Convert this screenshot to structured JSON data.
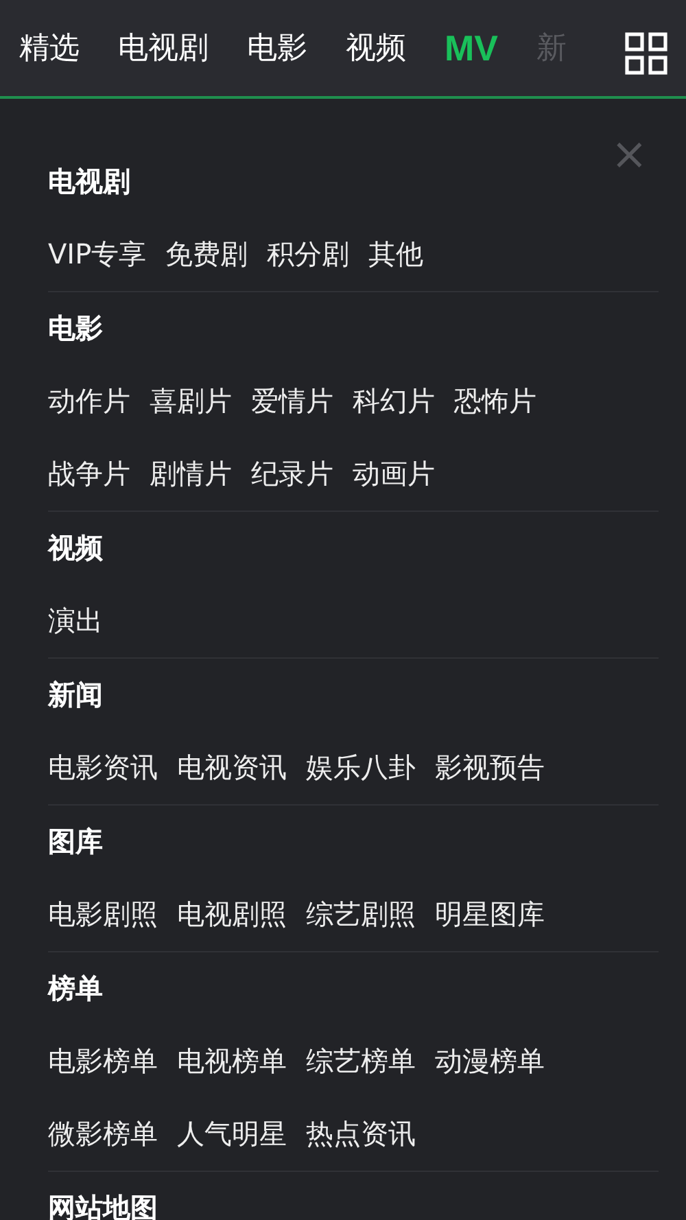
{
  "tabs": [
    {
      "label": "精选",
      "selected": false
    },
    {
      "label": "电视剧",
      "selected": false
    },
    {
      "label": "电影",
      "selected": false
    },
    {
      "label": "视频",
      "selected": false
    },
    {
      "label": "MV",
      "selected": true
    },
    {
      "label": "新",
      "selected": false
    }
  ],
  "close_label": "×",
  "sections": [
    {
      "title": "电视剧",
      "rows": [
        [
          "VIP专享",
          "免费剧",
          "积分剧",
          "其他"
        ]
      ]
    },
    {
      "title": "电影",
      "rows": [
        [
          "动作片",
          "喜剧片",
          "爱情片",
          "科幻片",
          "恐怖片"
        ],
        [
          "战争片",
          "剧情片",
          "纪录片",
          "动画片"
        ]
      ]
    },
    {
      "title": "视频",
      "rows": [
        [
          "演出"
        ]
      ]
    },
    {
      "title": "新闻",
      "rows": [
        [
          "电影资讯",
          "电视资讯",
          "娱乐八卦",
          "影视预告"
        ]
      ]
    },
    {
      "title": "图库",
      "rows": [
        [
          "电影剧照",
          "电视剧照",
          "综艺剧照",
          "明星图库"
        ]
      ]
    },
    {
      "title": "榜单",
      "rows": [
        [
          "电影榜单",
          "电视榜单",
          "综艺榜单",
          "动漫榜单"
        ],
        [
          "微影榜单",
          "人气明星",
          "热点资讯"
        ]
      ]
    },
    {
      "title": "网站地图"
    }
  ]
}
